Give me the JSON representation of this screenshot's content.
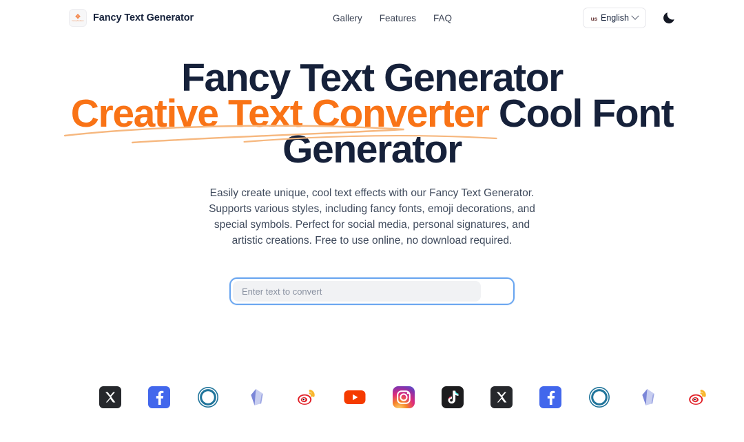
{
  "header": {
    "brand": {
      "name": "Fancy Text Generator",
      "logo_glyph": "✥",
      "logo_sub": "FancyTextGen"
    },
    "nav": [
      {
        "label": "Gallery"
      },
      {
        "label": "Features"
      },
      {
        "label": "FAQ"
      }
    ],
    "language": {
      "flag": "us",
      "label": "English"
    },
    "theme_toggle": "moon-icon"
  },
  "hero": {
    "title_part1": "Fancy Text Generator",
    "title_highlight": "Creative Text Converter",
    "title_part2": "Cool Font Generator",
    "subtitle": "Easily create unique, cool text effects with our Fancy Text Generator. Supports various styles, including fancy fonts, emoji decorations, and special symbols. Perfect for social media, personal signatures, and artistic creations. Free to use online, no download required."
  },
  "search": {
    "value": "",
    "placeholder": "Enter text to convert"
  },
  "marquee": {
    "items": [
      {
        "name": "x-twitter",
        "label": "X"
      },
      {
        "name": "facebook",
        "label": "Facebook"
      },
      {
        "name": "wordpress",
        "label": "WordPress"
      },
      {
        "name": "gem",
        "label": "Gem"
      },
      {
        "name": "weibo",
        "label": "Weibo"
      },
      {
        "name": "youtube",
        "label": "YouTube"
      },
      {
        "name": "instagram",
        "label": "Instagram"
      },
      {
        "name": "tiktok",
        "label": "TikTok"
      },
      {
        "name": "x-twitter",
        "label": "X"
      },
      {
        "name": "facebook",
        "label": "Facebook"
      },
      {
        "name": "wordpress",
        "label": "WordPress"
      },
      {
        "name": "gem",
        "label": "Gem"
      },
      {
        "name": "weibo",
        "label": "Weibo"
      }
    ]
  },
  "colors": {
    "accent_orange": "#F97316",
    "heading_navy": "#16213a",
    "focus_blue": "#6aa6f0",
    "swoosh": "#f6b77e"
  }
}
